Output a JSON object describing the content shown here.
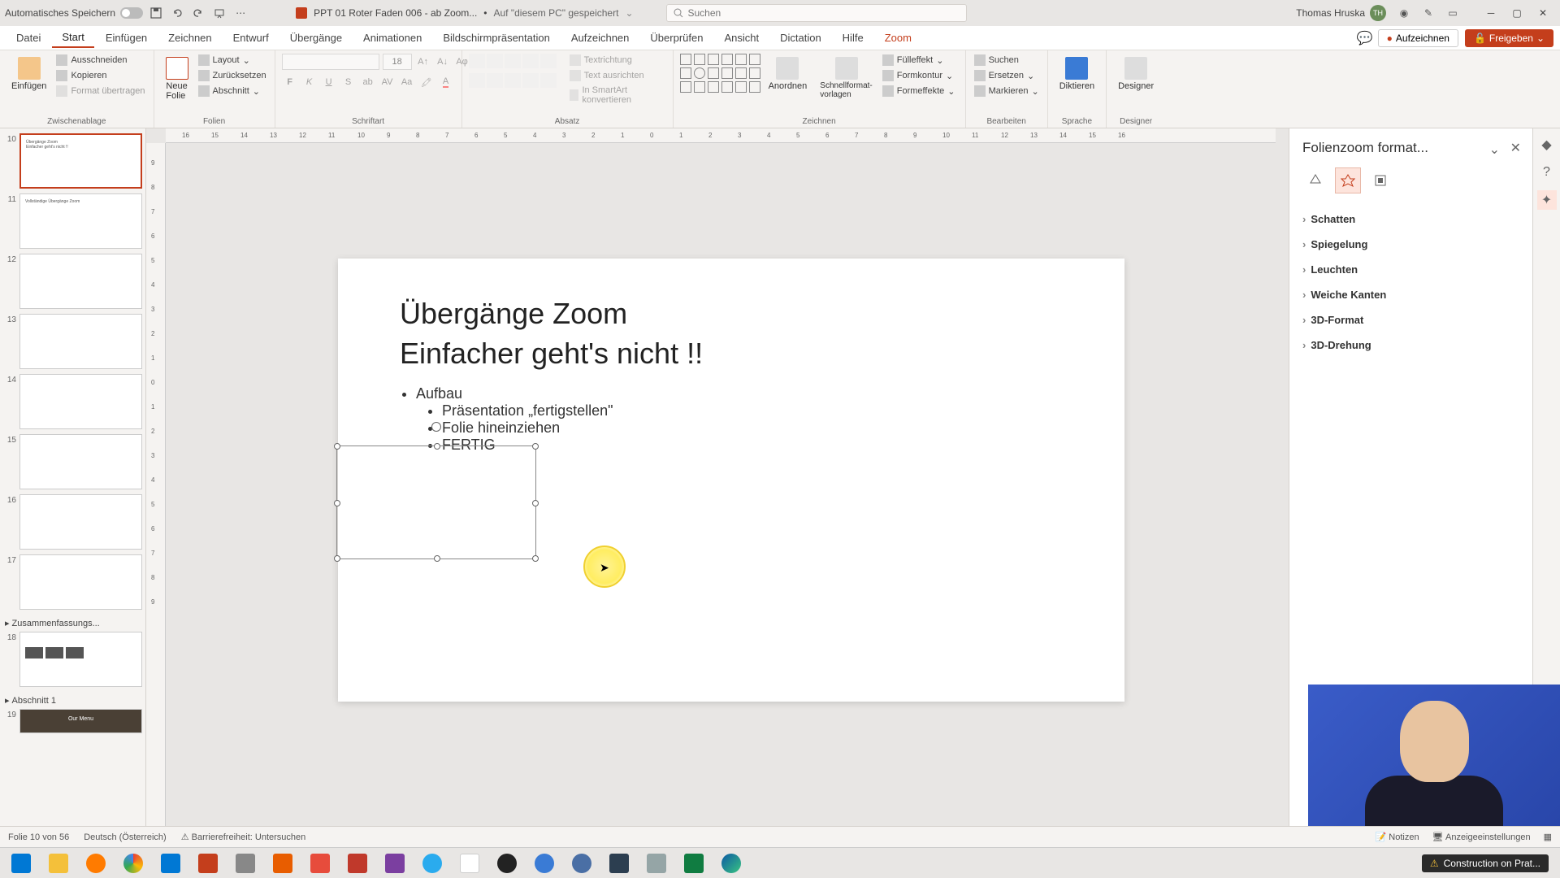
{
  "titlebar": {
    "autosave": "Automatisches Speichern",
    "doc_name": "PPT 01 Roter Faden 006 - ab Zoom...",
    "saved_location": "Auf \"diesem PC\" gespeichert",
    "search_placeholder": "Suchen",
    "user_name": "Thomas Hruska",
    "user_initials": "TH"
  },
  "tabs": {
    "datei": "Datei",
    "start": "Start",
    "einfuegen": "Einfügen",
    "zeichnen": "Zeichnen",
    "entwurf": "Entwurf",
    "uebergaenge": "Übergänge",
    "animationen": "Animationen",
    "bildschirm": "Bildschirmpräsentation",
    "aufzeichnen": "Aufzeichnen",
    "ueberpruefen": "Überprüfen",
    "ansicht": "Ansicht",
    "dictation": "Dictation",
    "hilfe": "Hilfe",
    "zoom": "Zoom",
    "record_btn": "Aufzeichnen",
    "share_btn": "Freigeben"
  },
  "ribbon": {
    "paste": "Einfügen",
    "cut": "Ausschneiden",
    "copy": "Kopieren",
    "format_painter": "Format übertragen",
    "clipboard": "Zwischenablage",
    "new_slide": "Neue\nFolie",
    "layout": "Layout",
    "reset": "Zurücksetzen",
    "section": "Abschnitt",
    "slides": "Folien",
    "font": "Schriftart",
    "font_size": "18",
    "paragraph": "Absatz",
    "text_direction": "Textrichtung",
    "align_text": "Text ausrichten",
    "smartart": "In SmartArt konvertieren",
    "arrange": "Anordnen",
    "quick_styles": "Schnellformat-\nvorlagen",
    "fill": "Fülleffekt",
    "outline": "Formkontur",
    "effects": "Formeffekte",
    "drawing": "Zeichnen",
    "find": "Suchen",
    "replace": "Ersetzen",
    "select": "Markieren",
    "editing": "Bearbeiten",
    "dictate": "Diktieren",
    "voice": "Sprache",
    "designer": "Designer",
    "designer_grp": "Designer"
  },
  "thumbs": {
    "n10": "10",
    "n11": "11",
    "n12": "12",
    "n13": "13",
    "n14": "14",
    "n15": "15",
    "n16": "16",
    "n17": "17",
    "n18": "18",
    "n19": "19",
    "section_summary": "Zusammenfassungs...",
    "section_1": "Abschnitt 1",
    "t10_l1": "Übergänge Zoom",
    "t10_l2": "Einfacher geht's nicht !!",
    "t11_l1": "Vollständige Übergänge Zoom",
    "t19_text": "Our Menu"
  },
  "slide": {
    "title_l1": "Übergänge Zoom",
    "title_l2": "Einfacher geht's nicht !!",
    "bullet1": "Aufbau",
    "bullet1a": "Präsentation „fertigstellen\"",
    "bullet1b": "Folie hineinziehen",
    "bullet1c": "FERTIG"
  },
  "format_pane": {
    "title": "Folienzoom format...",
    "schatten": "Schatten",
    "spiegelung": "Spiegelung",
    "leuchten": "Leuchten",
    "weiche_kanten": "Weiche Kanten",
    "format_3d": "3D-Format",
    "drehung_3d": "3D-Drehung"
  },
  "status": {
    "slide_of": "Folie 10 von 56",
    "language": "Deutsch (Österreich)",
    "accessibility": "Barrierefreiheit: Untersuchen",
    "notes": "Notizen",
    "display": "Anzeigeeinstellungen"
  },
  "taskbar": {
    "notification": "Construction on Prat..."
  },
  "ruler_h": [
    "16",
    "15",
    "14",
    "13",
    "12",
    "11",
    "10",
    "9",
    "8",
    "7",
    "6",
    "5",
    "4",
    "3",
    "2",
    "1",
    "0",
    "1",
    "2",
    "3",
    "4",
    "5",
    "6",
    "7",
    "8",
    "9",
    "10",
    "11",
    "12",
    "13",
    "14",
    "15",
    "16"
  ],
  "ruler_v": [
    "9",
    "8",
    "7",
    "6",
    "5",
    "4",
    "3",
    "2",
    "1",
    "0",
    "1",
    "2",
    "3",
    "4",
    "5",
    "6",
    "7",
    "8",
    "9"
  ]
}
